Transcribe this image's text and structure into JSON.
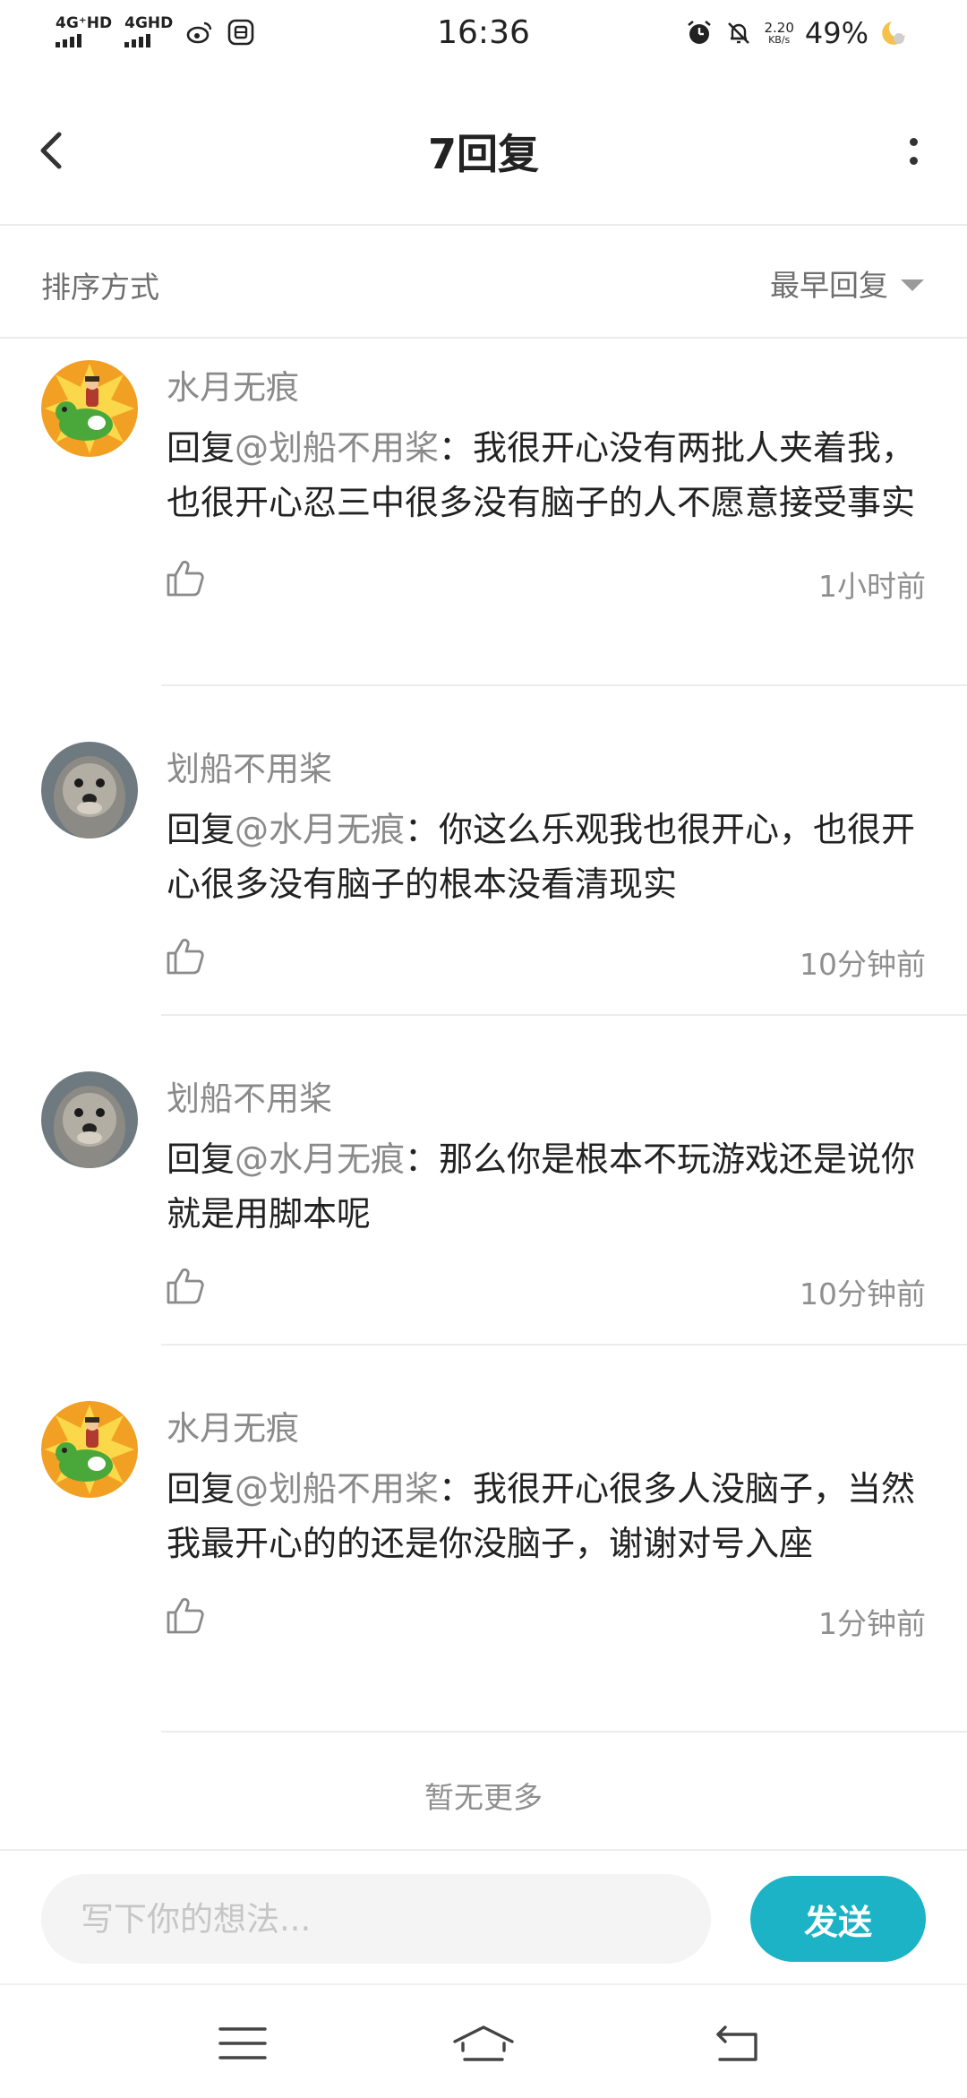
{
  "status_bar": {
    "network1": "4G⁺HD",
    "network2": "4GHD",
    "time": "16:36",
    "speed_value": "2.20",
    "speed_unit": "KB/s",
    "battery": "49%"
  },
  "header": {
    "title": "7回复"
  },
  "sort": {
    "label": "排序方式",
    "selected": "最早回复"
  },
  "replies": [
    {
      "username": "水月无痕",
      "prefix": "回复",
      "mention": "@划船不用桨",
      "text": "：我很开心没有两批人夹着我，也很开心忍三中很多没有脑子的人不愿意接受事实",
      "time": "1小时前",
      "avatar": "yoshi-rider"
    },
    {
      "username": "划船不用桨",
      "prefix": "回复",
      "mention": "@水月无痕",
      "text": "：你这么乐观我也很开心，也很开心很多没有脑子的根本没看清现实",
      "time": "10分钟前",
      "avatar": "otter"
    },
    {
      "username": "划船不用桨",
      "prefix": "回复",
      "mention": "@水月无痕",
      "text": "：那么你是根本不玩游戏还是说你就是用脚本呢",
      "time": "10分钟前",
      "avatar": "otter"
    },
    {
      "username": "水月无痕",
      "prefix": "回复",
      "mention": "@划船不用桨",
      "text": "：我很开心很多人没脑子，当然我最开心的的还是你没脑子，谢谢对号入座",
      "time": "1分钟前",
      "avatar": "yoshi-rider"
    }
  ],
  "no_more": "暂无更多",
  "composer": {
    "placeholder": "写下你的想法...",
    "send_label": "发送",
    "send_color": "#1bb3c5"
  }
}
